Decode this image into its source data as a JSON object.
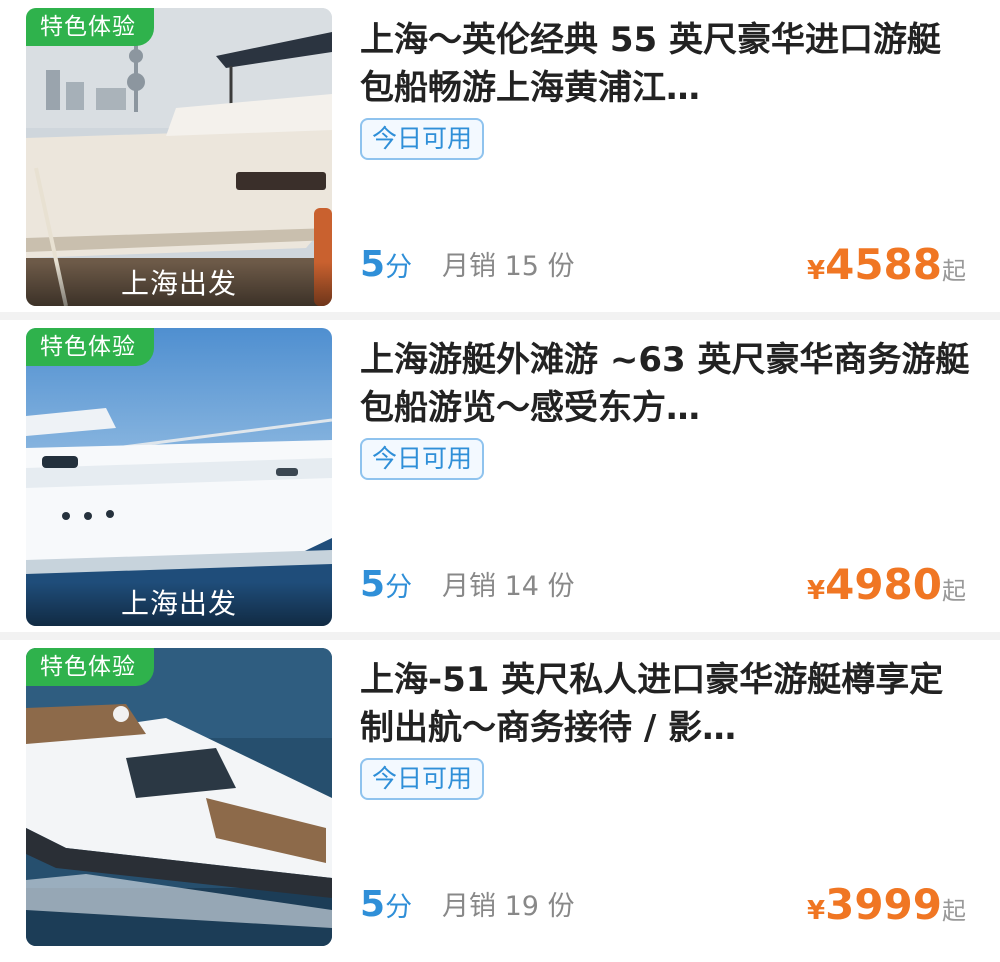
{
  "items": [
    {
      "badge": "特色体验",
      "depart": "上海出发",
      "title": "上海～英伦经典 55 英尺豪华进口游艇 包船畅游上海黄浦江…",
      "availability": "今日可用",
      "score": "5",
      "score_unit": "分",
      "sales": "月销 15 份",
      "currency": "¥",
      "price": "4588",
      "price_suffix": "起",
      "image": "white yacht moored at Shanghai dock with Oriental Pearl Tower skyline"
    },
    {
      "badge": "特色体验",
      "depart": "上海出发",
      "title": "上海游艇外滩游 ~63 英尺豪华商务游艇包船游览～感受东方…",
      "availability": "今日可用",
      "score": "5",
      "score_unit": "分",
      "sales": "月销 14 份",
      "currency": "¥",
      "price": "4980",
      "price_suffix": "起",
      "image": "white luxury yacht on blue sea under blue sky"
    },
    {
      "badge": "特色体验",
      "title": "上海-51 英尺私人进口豪华游艇樽享定制出航～商务接待 / 影…",
      "availability": "今日可用",
      "score": "5",
      "score_unit": "分",
      "sales": "月销 19 份",
      "currency": "¥",
      "price": "3999",
      "price_suffix": "起",
      "image": "white luxury yacht cruising at speed on open water"
    }
  ]
}
